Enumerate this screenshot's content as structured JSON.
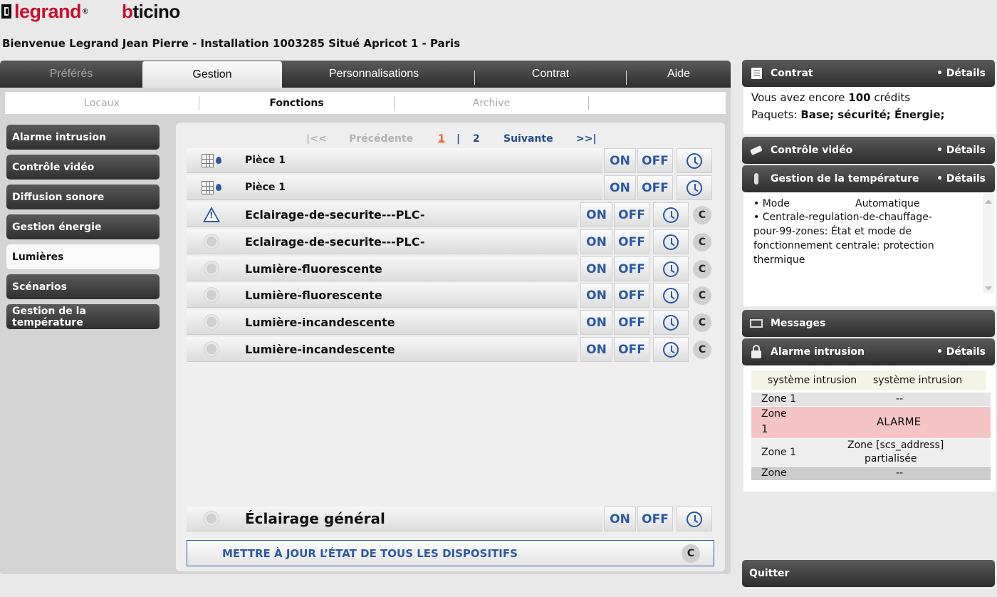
{
  "brand": {
    "legrand": "legrand",
    "registered": "®",
    "bticino": "bticino"
  },
  "welcome": "Bienvenue Legrand Jean Pierre - Installation 1003285 Situé Apricot 1 - Paris",
  "topnav": [
    "Préférés",
    "Gestion",
    "Personnalisations",
    "Contrat",
    "Aide"
  ],
  "subnav": [
    "Locaux",
    "Fonctions",
    "Archive"
  ],
  "sidebar": [
    "Alarme intrusion",
    "Contrôle vidéo",
    "Diffusion sonore",
    "Gestion énergie",
    "Lumières",
    "Scénarios",
    "Gestion de la température"
  ],
  "pager": {
    "first": "|<<",
    "prev": "Précédente",
    "current": "1",
    "sep": "|",
    "page2": "2",
    "next": "Suivante",
    "last": ">>|"
  },
  "rows": [
    {
      "label": "Pièce 1",
      "icon": "thermostat-icon",
      "on": "ON",
      "off": "OFF"
    },
    {
      "label": "Pièce 1",
      "icon": "thermostat-icon",
      "on": "ON",
      "off": "OFF"
    },
    {
      "label": "Eclairage-de-securite---PLC-",
      "icon": "warning-icon",
      "on": "ON",
      "off": "OFF"
    },
    {
      "label": "Eclairage-de-securite---PLC-",
      "icon": "light-bulb-icon",
      "on": "ON",
      "off": "OFF"
    },
    {
      "label": "Lumière-fluorescente",
      "icon": "light-bulb-icon",
      "on": "ON",
      "off": "OFF"
    },
    {
      "label": "Lumière-fluorescente",
      "icon": "light-bulb-icon",
      "on": "ON",
      "off": "OFF"
    },
    {
      "label": "Lumière-incandescente",
      "icon": "light-bulb-icon",
      "on": "ON",
      "off": "OFF"
    },
    {
      "label": "Lumière-incandescente",
      "icon": "light-bulb-icon",
      "on": "ON",
      "off": "OFF"
    }
  ],
  "general": {
    "label": "Éclairage général",
    "on": "ON",
    "off": "OFF"
  },
  "update_all": "METTRE À JOUR L’ÉTAT DE TOUS LES DISPOSITIFS",
  "refresh_glyph": "C",
  "widgets": {
    "details": "• Détails",
    "contrat": {
      "title": "Contrat",
      "line1_pre": "Vous avez encore ",
      "credits": "100",
      "line1_post": " crédits",
      "line2_pre": "Paquets: ",
      "packages": "Base; sécurité; Énergie;"
    },
    "video": {
      "title": "Contrôle vidéo"
    },
    "temperature": {
      "title": "Gestion de la température",
      "mode_label": "• Mode",
      "mode_value": "Automatique",
      "line2": "• Centrale-regulation-de-chauffage-",
      "line3": "pour-99-zones: État et mode de",
      "line4": "fonctionnement centrale: protection",
      "line5": "thermique"
    },
    "messages": {
      "title": "Messages"
    },
    "alarme": {
      "title": "Alarme intrusion",
      "header_col1": "système intrusion",
      "header_col2": "système intrusion",
      "rows": [
        {
          "zone": "Zone 1",
          "status": "--"
        },
        {
          "zone_a": "Zone",
          "zone_b": "1",
          "status": "ALARME"
        },
        {
          "zone": "Zone 1",
          "status_a": "Zone [scs_address]",
          "status_b": "partialisée"
        },
        {
          "zone": "Zone",
          "status": "--"
        }
      ]
    },
    "quitter": "Quitter"
  },
  "colors": {
    "brand_red": "#c8102e",
    "accent_blue": "#2b59a3",
    "pager_current": "#f15a22",
    "alarm_bg": "#f5c4c4"
  }
}
